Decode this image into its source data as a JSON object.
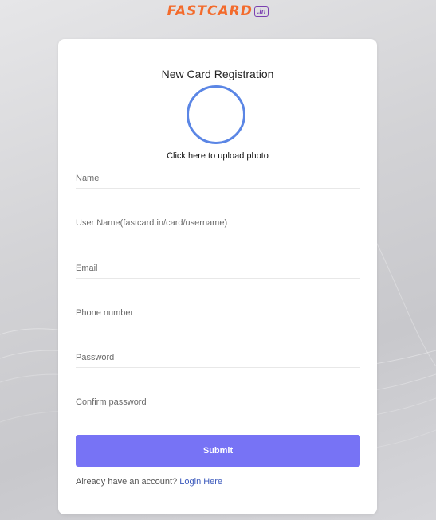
{
  "brand": {
    "logo_text": "FASTCARD",
    "logo_badge": ".in",
    "logo_color": "#f36b2c",
    "badge_color": "#7a3fb0"
  },
  "form": {
    "title": "New Card Registration",
    "upload_label": "Click here to upload photo",
    "fields": {
      "name": "Name",
      "username": "User Name(fastcard.in/card/username)",
      "email": "Email",
      "phone": "Phone number",
      "password": "Password",
      "confirm_password": "Confirm password"
    },
    "submit_label": "Submit",
    "login_prompt": "Already have an account?",
    "login_link": "Login Here"
  },
  "colors": {
    "accent": "#7773f5",
    "circle": "#5b86e5",
    "link": "#3d5bbd"
  }
}
